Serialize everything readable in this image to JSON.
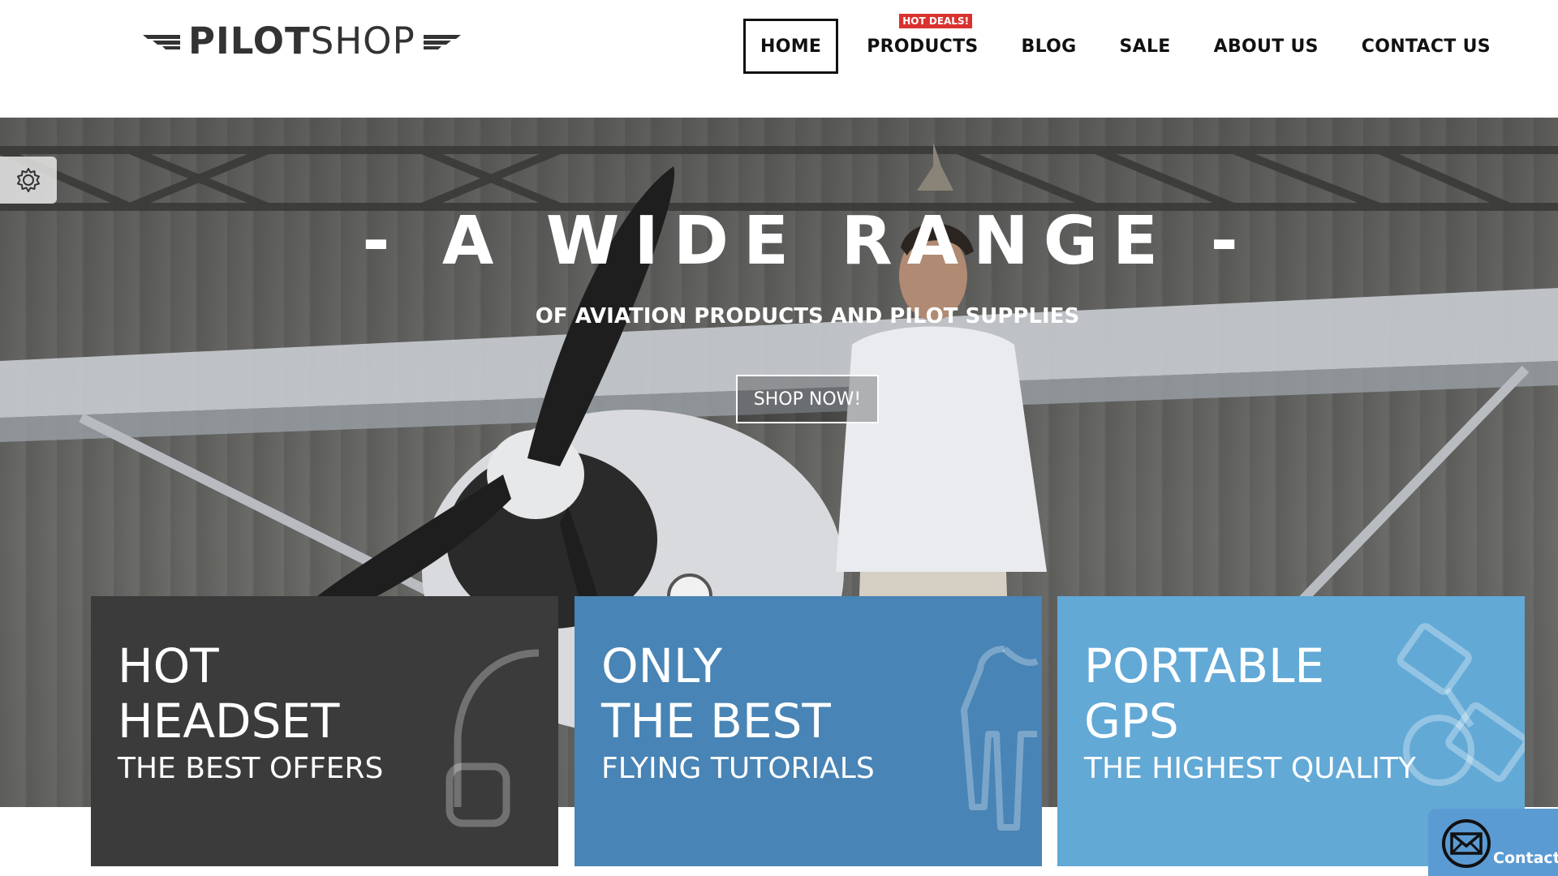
{
  "brand": {
    "name_bold": "PILOT",
    "name_light": "SHOP"
  },
  "nav": {
    "items": [
      {
        "label": "HOME",
        "active": true
      },
      {
        "label": "PRODUCTS",
        "badge": "HOT DEALS!"
      },
      {
        "label": "BLOG"
      },
      {
        "label": "SALE"
      },
      {
        "label": "ABOUT US"
      },
      {
        "label": "CONTACT US"
      }
    ]
  },
  "hero": {
    "title": "- A WIDE RANGE -",
    "subtitle": "OF AVIATION PRODUCTS AND PILOT SUPPLIES",
    "cta": "SHOP NOW!"
  },
  "cards": [
    {
      "line1": "HOT",
      "line2": "HEADSET",
      "sub": "THE BEST OFFERS",
      "icon": "headset-icon",
      "color": "#3b3b3b"
    },
    {
      "line1": "ONLY",
      "line2": "THE BEST",
      "sub": "FLYING TUTORIALS",
      "icon": "flight-suit-icon",
      "color": "#4884b5"
    },
    {
      "line1": "PORTABLE",
      "line2": "GPS",
      "sub": "THE HIGHEST QUALITY",
      "icon": "satellite-icon",
      "color": "#62a9d6"
    }
  ],
  "contact_widget": {
    "label": "Contact",
    "icon": "envelope-icon"
  },
  "settings": {
    "icon": "gear-icon"
  },
  "colors": {
    "hot_badge": "#d9322f",
    "card_dark": "#3b3b3b",
    "card_mid": "#4884b5",
    "card_light": "#62a9d6",
    "contact_widget": "#5b9bd3"
  }
}
